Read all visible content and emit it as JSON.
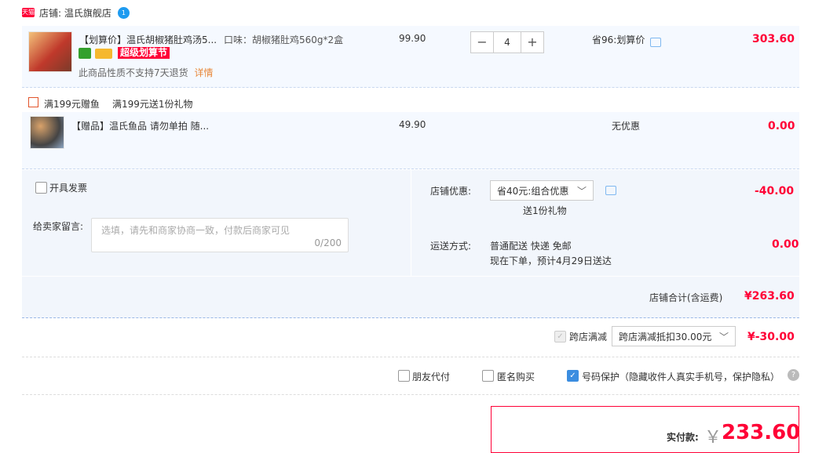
{
  "shop": {
    "badge": "天猫",
    "label": "店铺: 温氏旗舰店",
    "ww_badge": "1"
  },
  "items": [
    {
      "title": "【划算价】温氏胡椒猪肚鸡汤5...",
      "spec": "口味：胡椒猪肚鸡560g*2盒",
      "unit_price": "99.90",
      "qty": "4",
      "promo": "省96:划算价",
      "total": "303.60",
      "badge_label": "超级划算节",
      "note": "此商品性质不支持7天退货",
      "note_link": "详情"
    },
    {
      "title": "【赠品】温氏鱼品 请勿单拍 随...",
      "unit_price": "49.90",
      "promo": "无优惠",
      "total": "0.00"
    }
  ],
  "gift_promo": {
    "tag": "满199元赠鱼",
    "text": "满199元送1份礼物"
  },
  "invoice": {
    "label": "开具发票"
  },
  "message": {
    "label": "给卖家留言:",
    "placeholder": "选填，请先和商家协商一致，付款后商家可见",
    "count": "0/200"
  },
  "shop_discount": {
    "label": "店铺优惠:",
    "selected": "省40元:组合优惠",
    "sub": "送1份礼物",
    "amount": "-40.00"
  },
  "shipping": {
    "label": "运送方式:",
    "method": "普通配送 快递 免邮",
    "eta": "现在下单，预计4月29日送达",
    "amount": "0.00"
  },
  "shop_total": {
    "label": "店铺合计(含运费)",
    "amount": "¥263.60"
  },
  "cross_store": {
    "label": "跨店满减",
    "selected": "跨店满减抵扣30.00元",
    "amount": "¥-30.00"
  },
  "options": [
    {
      "label": "朋友代付",
      "checked": false
    },
    {
      "label": "匿名购买",
      "checked": false
    },
    {
      "label": "号码保护（隐藏收件人真实手机号，保护隐私）",
      "checked": true
    }
  ],
  "payment": {
    "label": "实付款:",
    "currency": "￥",
    "amount": "233.60"
  },
  "colors": {
    "accent": "#ff0036",
    "panel": "#f5f9ff",
    "link": "#3b8de0"
  }
}
